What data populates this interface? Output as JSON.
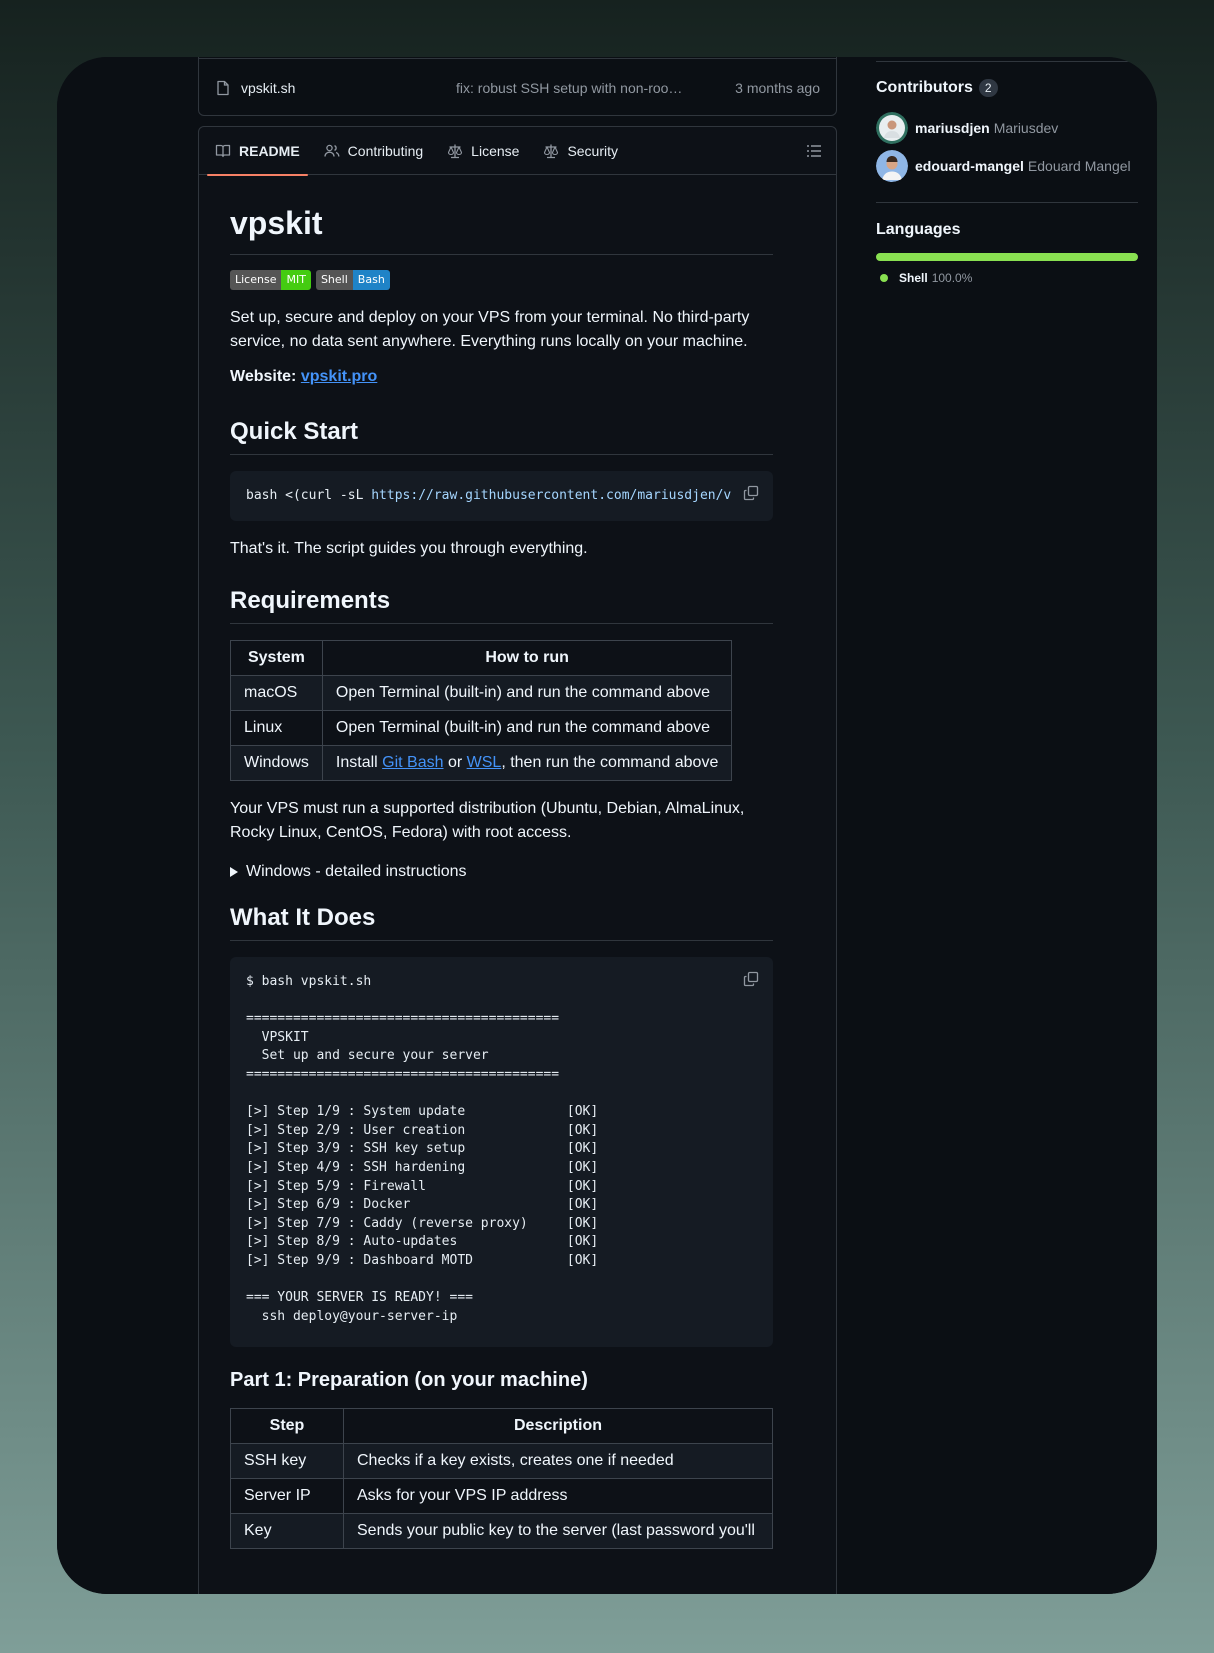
{
  "file_row": {
    "name": "vpskit.sh",
    "commit_message": "fix: robust SSH setup with non-roo…",
    "date": "3 months ago"
  },
  "tabs": [
    {
      "label": "README",
      "icon": "book-icon"
    },
    {
      "label": "Contributing",
      "icon": "people-icon"
    },
    {
      "label": "License",
      "icon": "law-icon"
    },
    {
      "label": "Security",
      "icon": "law-icon"
    }
  ],
  "readme": {
    "title": "vpskit",
    "badges": [
      {
        "left": "License",
        "right": "MIT",
        "color": "#44cc11"
      },
      {
        "left": "Shell",
        "right": "Bash",
        "color": "#1f83c7"
      }
    ],
    "intro": "Set up, secure and deploy on your VPS from your terminal. No third-party service, no data sent anywhere. Everything runs locally on your machine.",
    "website_label": "Website:",
    "website_link": "vpskit.pro",
    "quick_start_heading": "Quick Start",
    "quick_start_command_prefix": "bash <(curl -sL ",
    "quick_start_command_url": "https://raw.githubusercontent.com/mariusdjen/vp",
    "quick_start_after": "That's it. The script guides you through everything.",
    "requirements_heading": "Requirements",
    "requirements_table": {
      "headers": [
        "System",
        "How to run"
      ],
      "rows": [
        {
          "system": "macOS",
          "how": "Open Terminal (built-in) and run the command above"
        },
        {
          "system": "Linux",
          "how": "Open Terminal (built-in) and run the command above"
        },
        {
          "system": "Windows",
          "how_prefix": "Install ",
          "link1": "Git Bash",
          "how_mid": " or ",
          "link2": "WSL",
          "how_suffix": ", then run the command above"
        }
      ]
    },
    "requirements_note": "Your VPS must run a supported distribution (Ubuntu, Debian, AlmaLinux, Rocky Linux, CentOS, Fedora) with root access.",
    "details_summary": "Windows - detailed instructions",
    "what_it_does_heading": "What It Does",
    "terminal_output": "$ bash vpskit.sh\n\n========================================\n  VPSKIT\n  Set up and secure your server\n========================================\n\n[>] Step 1/9 : System update             [OK]\n[>] Step 2/9 : User creation             [OK]\n[>] Step 3/9 : SSH key setup             [OK]\n[>] Step 4/9 : SSH hardening             [OK]\n[>] Step 5/9 : Firewall                  [OK]\n[>] Step 6/9 : Docker                    [OK]\n[>] Step 7/9 : Caddy (reverse proxy)     [OK]\n[>] Step 8/9 : Auto-updates              [OK]\n[>] Step 9/9 : Dashboard MOTD            [OK]\n\n=== YOUR SERVER IS READY! ===\n  ssh deploy@your-server-ip",
    "part1_heading": "Part 1: Preparation (on your machine)",
    "part1_table": {
      "headers": [
        "Step",
        "Description"
      ],
      "rows": [
        {
          "step": "SSH key",
          "desc": "Checks if a key exists, creates one if needed"
        },
        {
          "step": "Server IP",
          "desc": "Asks for your VPS IP address"
        },
        {
          "step": "Key",
          "desc": "Sends your public key to the server (last password you'll"
        }
      ]
    }
  },
  "sidebar": {
    "contributors_heading": "Contributors",
    "contributors_count": "2",
    "contributors": [
      {
        "login": "mariusdjen",
        "name": "Mariusdev"
      },
      {
        "login": "edouard-mangel",
        "name": "Edouard Mangel"
      }
    ],
    "languages_heading": "Languages",
    "languages": [
      {
        "name": "Shell",
        "percent": "100.0%",
        "fraction": 1.0,
        "color": "#89e051"
      }
    ]
  }
}
